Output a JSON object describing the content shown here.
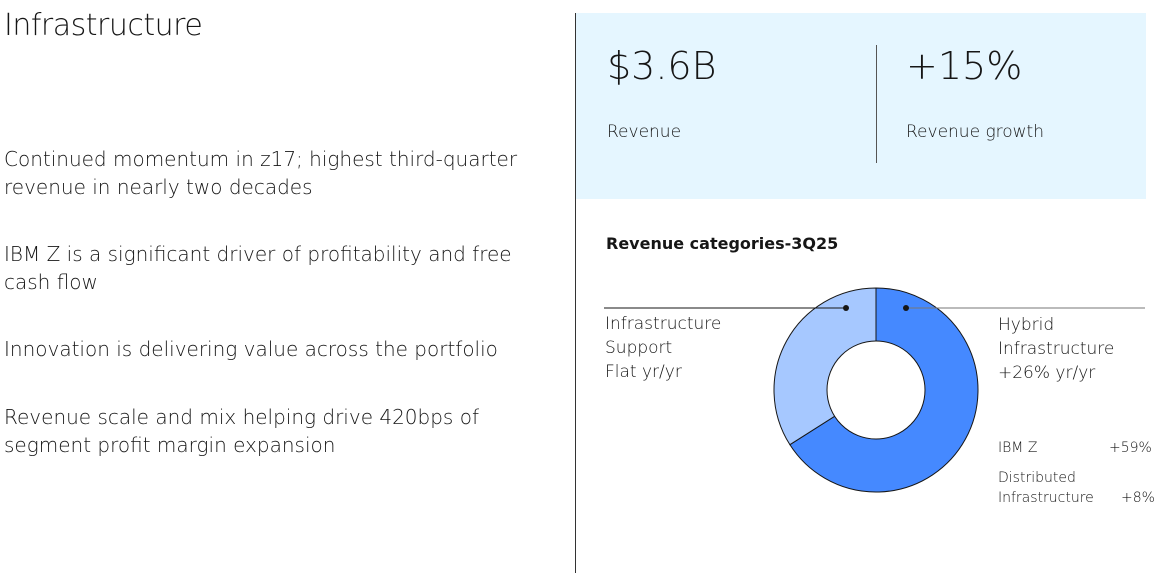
{
  "title": "Infrastructure",
  "bullets": [
    "Continued momentum in z17; highest third-quarter revenue in nearly two decades",
    "IBM Z is a significant driver of profitability and free cash flow",
    "Innovation is delivering value across the portfolio",
    "Revenue scale and mix helping drive 420bps of segment profit margin expansion"
  ],
  "kpis": [
    {
      "value": "$3.6B",
      "label": "Revenue"
    },
    {
      "value": "+15%",
      "label": "Revenue growth"
    }
  ],
  "colors": {
    "panel": "#e5f6ff",
    "hybrid": "#4589ff",
    "support": "#a6c8ff"
  },
  "chart_data": {
    "type": "pie",
    "title": "Revenue categories-3Q25",
    "slices": [
      {
        "name": "Hybrid Infrastructure",
        "value": 66,
        "line1": "Hybrid",
        "line2": "Infrastructure",
        "growth": "+26% yr/yr",
        "color": "#4589ff"
      },
      {
        "name": "Infrastructure Support",
        "value": 34,
        "line1": "Infrastructure",
        "line2": "Support",
        "growth": "Flat yr/yr",
        "color": "#a6c8ff"
      }
    ],
    "sub_items": [
      {
        "name": "IBM Z",
        "growth": "+59%"
      },
      {
        "name_line1": "Distributed",
        "name_line2": "Infrastructure",
        "growth": "+8%"
      }
    ]
  }
}
